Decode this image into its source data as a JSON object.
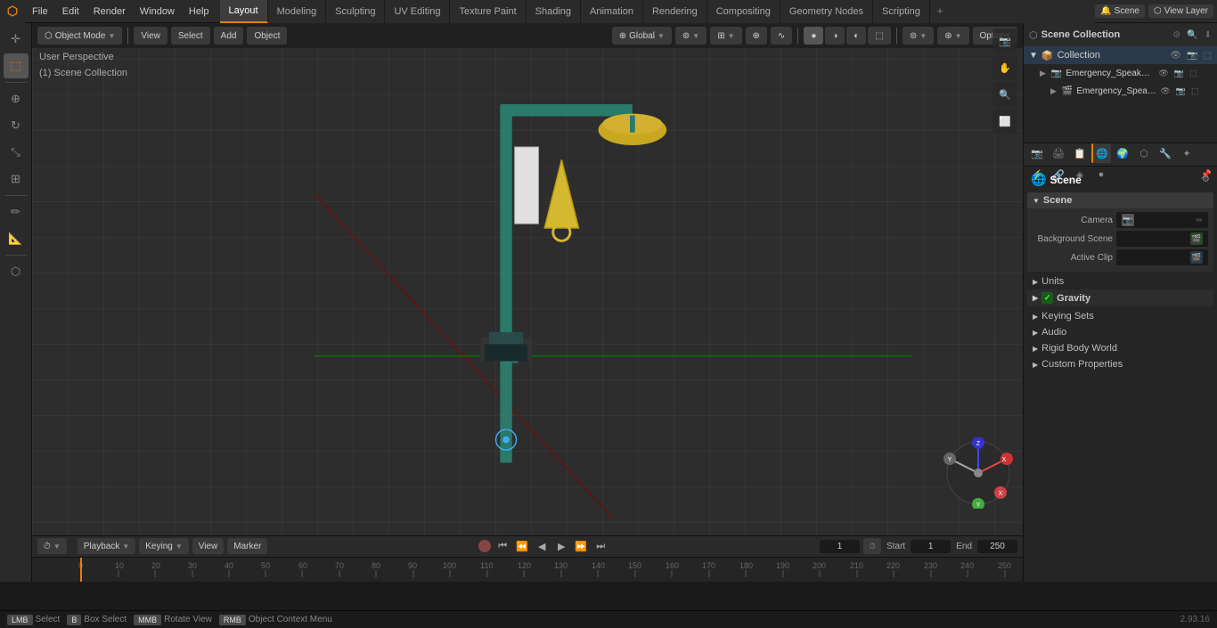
{
  "app": {
    "title": "Blender",
    "version": "2.93.16"
  },
  "top_menu": {
    "logo": "⬡",
    "items": [
      "File",
      "Edit",
      "Render",
      "Window",
      "Help"
    ],
    "workspace_tabs": [
      "Layout",
      "Modeling",
      "Sculpting",
      "UV Editing",
      "Texture Paint",
      "Shading",
      "Animation",
      "Rendering",
      "Compositing",
      "Geometry Nodes",
      "Scripting"
    ],
    "active_tab": "Layout",
    "add_tab_icon": "+",
    "right": {
      "scene_icon": "🔔",
      "scene_name": "Scene",
      "view_layer_label": "View Layer"
    }
  },
  "viewport": {
    "mode": "Object Mode",
    "view": "View",
    "select": "Select",
    "add": "Add",
    "object": "Object",
    "transform": "Global",
    "label_line1": "User Perspective",
    "label_line2": "(1) Scene Collection",
    "options_btn": "Options"
  },
  "outliner": {
    "title": "Scene Collection",
    "search_placeholder": "",
    "items": [
      {
        "name": "Emergency_Speakman_Show",
        "icon": "📷",
        "indent": 1,
        "actions": [
          "eye",
          "camera",
          "restrict"
        ]
      },
      {
        "name": "Emergency_Speakman_S",
        "icon": "🎬",
        "indent": 2,
        "actions": [
          "eye",
          "camera",
          "restrict"
        ]
      }
    ]
  },
  "properties": {
    "tabs": [
      {
        "id": "render",
        "icon": "📷",
        "active": false
      },
      {
        "id": "output",
        "icon": "🖨",
        "active": false
      },
      {
        "id": "view_layer",
        "icon": "📋",
        "active": false
      },
      {
        "id": "scene",
        "icon": "🌐",
        "active": true
      },
      {
        "id": "world",
        "icon": "🌍",
        "active": false
      },
      {
        "id": "object",
        "icon": "⬡",
        "active": false
      },
      {
        "id": "modifier",
        "icon": "🔧",
        "active": false
      },
      {
        "id": "particles",
        "icon": "✦",
        "active": false
      },
      {
        "id": "physics",
        "icon": "⚡",
        "active": false
      },
      {
        "id": "constraints",
        "icon": "🔗",
        "active": false
      },
      {
        "id": "data",
        "icon": "◈",
        "active": false
      },
      {
        "id": "material",
        "icon": "●",
        "active": false
      },
      {
        "id": "texture",
        "icon": "⬛",
        "active": false
      }
    ],
    "header_label": "Scene",
    "pin_icon": "📌",
    "sections": {
      "scene_title": "Scene",
      "camera_label": "Camera",
      "camera_value": "",
      "background_scene_label": "Background Scene",
      "background_scene_value": "",
      "active_clip_label": "Active Clip",
      "active_clip_value": "",
      "units_label": "Units",
      "gravity_label": "Gravity",
      "gravity_checked": true,
      "keying_sets_label": "Keying Sets",
      "audio_label": "Audio",
      "rigid_body_world_label": "Rigid Body World",
      "custom_properties_label": "Custom Properties"
    }
  },
  "timeline": {
    "playback_btn": "Playback",
    "keying_btn": "Keying",
    "view_btn": "View",
    "marker_btn": "Marker",
    "frame_current": "1",
    "start_label": "Start",
    "start_value": "1",
    "end_label": "End",
    "end_value": "250",
    "frame_markers": [
      0,
      10,
      20,
      30,
      40,
      50,
      60,
      70,
      80,
      90,
      100,
      110,
      120,
      130,
      140,
      150,
      160,
      170,
      180,
      190,
      200,
      210,
      220,
      230,
      240,
      250
    ]
  },
  "status_bar": {
    "select_label": "Select",
    "box_select_label": "Box Select",
    "rotate_view_label": "Rotate View",
    "context_menu_label": "Object Context Menu",
    "version": "2.93.16"
  },
  "collection_label": "Collection"
}
